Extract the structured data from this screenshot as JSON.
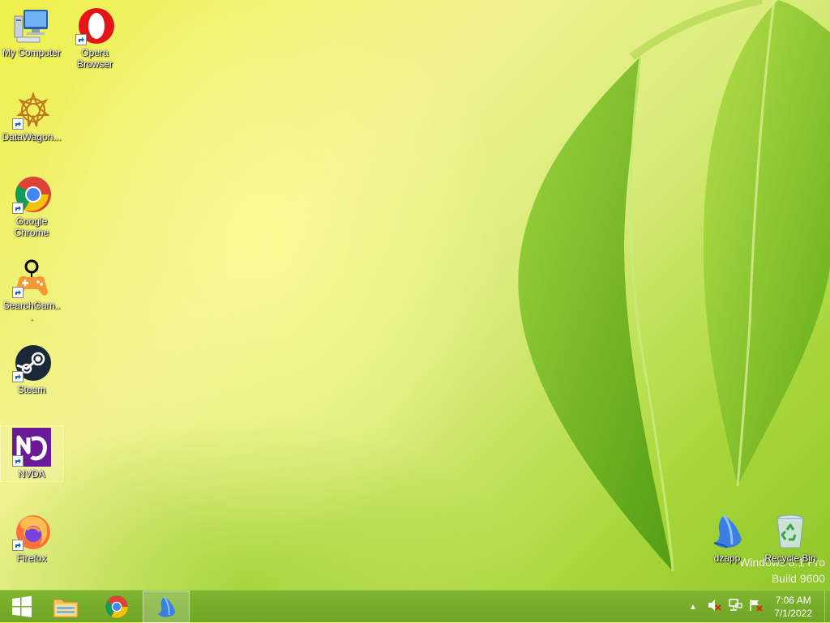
{
  "desktop": {
    "icons": [
      {
        "label": "My Computer"
      },
      {
        "label": "Opera Browser"
      },
      {
        "label": "DataWagon..."
      },
      {
        "label": "Google Chrome"
      },
      {
        "label": "SearchGam..."
      },
      {
        "label": "Steam"
      },
      {
        "label": "NVDA"
      },
      {
        "label": "Firefox"
      },
      {
        "label": "dzapp"
      },
      {
        "label": "Recycle Bin"
      }
    ],
    "watermark": {
      "line1": "Windows 8.1 Pro",
      "line2": "Build 9600"
    }
  },
  "taskbar": {
    "clock": {
      "time": "7:06 AM",
      "date": "7/1/2022"
    }
  },
  "colors": {
    "taskbar": "#75ad2a",
    "nvda_purple": "#6a1b9a",
    "opera_red": "#e3151a"
  }
}
